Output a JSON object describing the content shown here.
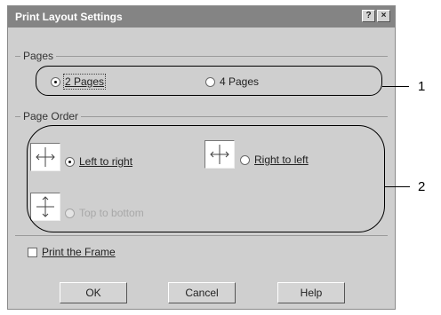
{
  "dialog": {
    "title": "Print Layout Settings",
    "help_glyph": "?",
    "close_glyph": "×"
  },
  "pages_group": {
    "label": "Pages",
    "options": [
      {
        "label": "2 Pages",
        "checked": true
      },
      {
        "label": "4 Pages",
        "checked": false
      }
    ]
  },
  "page_order_group": {
    "label": "Page Order",
    "options": [
      {
        "label": "Left to right",
        "checked": true,
        "enabled": true,
        "icon": "left-to-right-order-icon"
      },
      {
        "label": "Right to left",
        "checked": false,
        "enabled": true,
        "icon": "right-to-left-order-icon"
      },
      {
        "label": "Top to bottom",
        "checked": false,
        "enabled": false,
        "icon": "top-to-bottom-order-icon"
      }
    ]
  },
  "print_frame": {
    "label": "Print the Frame",
    "checked": false
  },
  "buttons": {
    "ok": "OK",
    "cancel": "Cancel",
    "help": "Help"
  },
  "callouts": [
    "1",
    "2"
  ]
}
